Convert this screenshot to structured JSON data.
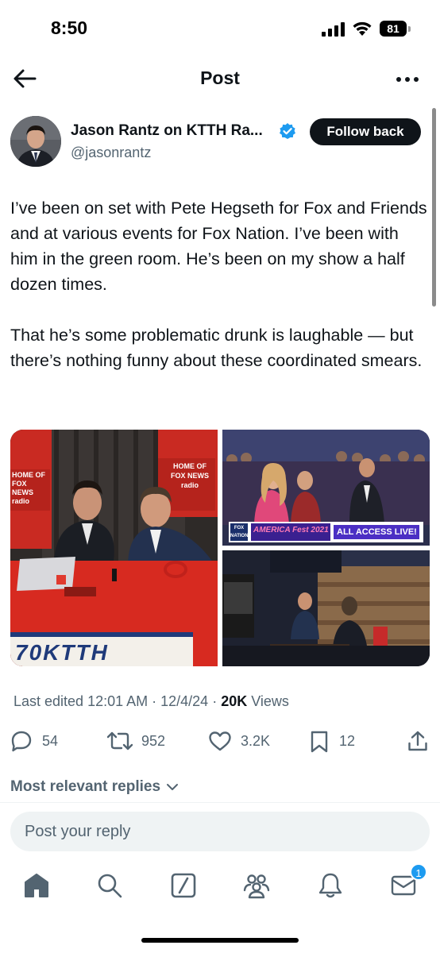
{
  "status_bar": {
    "time": "8:50",
    "battery": "81"
  },
  "header": {
    "title": "Post"
  },
  "author": {
    "name": "Jason Rantz on KTTH Ra...",
    "handle": "@jasonrantz",
    "follow_label": "Follow back"
  },
  "post": {
    "text": "I’ve been on set with Pete Hegseth for Fox and Friends and at various events for Fox Nation. I’ve been with him in the green room. He’s been on my show a half dozen times.\n\nThat he’s some problematic drunk is laughable — but there’s nothing funny about these coordinated smears."
  },
  "media": {
    "photo1_sign_left": "HOME OF FOX NEWS radio",
    "photo1_sign_right": "HOME OF FOX NEWS radio",
    "photo1_banner": "70KTTH",
    "photo2_banner_logo": "FOX NATION",
    "photo2_banner_title": "AMERICA Fest 2021",
    "photo2_banner_right": "ALL ACCESS LIVE!"
  },
  "meta": {
    "edited": "Last edited 12:01 AM",
    "date": "12/4/24",
    "views_count": "20K",
    "views_label": "Views"
  },
  "actions": {
    "replies": "54",
    "reposts": "952",
    "likes": "3.2K",
    "bookmarks": "12"
  },
  "replies_filter": "Most relevant replies",
  "reply": {
    "placeholder": "Post your reply"
  },
  "nav": {
    "messages_badge": "1"
  },
  "colors": {
    "accent": "#1d9bf0",
    "text": "#0f1419",
    "muted": "#536471"
  }
}
